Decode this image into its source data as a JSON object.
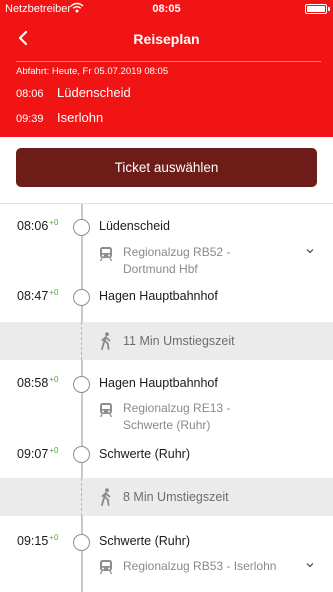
{
  "status_bar": {
    "carrier": "Netzbetreiber",
    "time": "08:05"
  },
  "nav": {
    "title": "Reiseplan",
    "back_icon": "chevron-left-icon"
  },
  "summary": {
    "departure": "Abfahrt: Heute, Fr 05.07.2019 08:05",
    "from": {
      "time": "08:06",
      "station": "Lüdenscheid"
    },
    "to": {
      "time": "09:39",
      "station": "Iserlohn"
    }
  },
  "ticket_button": {
    "label": "Ticket auswählen"
  },
  "itinerary": {
    "stop1": {
      "time": "08:06",
      "delay": "+0",
      "station": "Lüdenscheid"
    },
    "leg1": {
      "train": "Regionalzug RB52 -",
      "destination": "Dortmund Hbf"
    },
    "stop2": {
      "time": "08:47",
      "delay": "+0",
      "station": "Hagen Hauptbahnhof"
    },
    "transfer1": {
      "text": "11 Min Umstiegszeit"
    },
    "stop3": {
      "time": "08:58",
      "delay": "+0",
      "station": "Hagen Hauptbahnhof"
    },
    "leg2": {
      "train": "Regionalzug RE13 -",
      "destination": "Schwerte (Ruhr)"
    },
    "stop4": {
      "time": "09:07",
      "delay": "+0",
      "station": "Schwerte (Ruhr)"
    },
    "transfer2": {
      "text": "8 Min Umstiegszeit"
    },
    "stop5": {
      "time": "09:15",
      "delay": "+0",
      "station": "Schwerte (Ruhr)"
    },
    "leg3": {
      "train": "Regionalzug RB53 - Iserlohn"
    }
  },
  "colors": {
    "header_bg": "#f01414",
    "ticket_button_bg": "#6d1c17",
    "delay_green": "#51a839",
    "transfer_bg": "#ebebeb"
  }
}
